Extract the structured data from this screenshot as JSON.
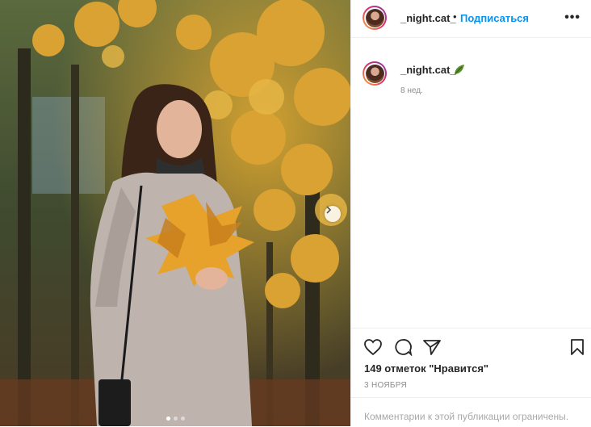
{
  "post": {
    "username": "_night.cat_",
    "separator": "•",
    "follow_label": "Подписаться",
    "more_icon": "more-horizontal-icon",
    "more_label": "•••",
    "caption_time": "8 нед.",
    "caption_icon": "leaf-icon",
    "likes_text": "149 отметок \"Нравится\"",
    "date_text": "3 НОЯБРЯ",
    "comments_disabled": "Комментарии к этой публикации ограничены.",
    "carousel": {
      "current": 1,
      "total": 3
    },
    "icons": [
      "heart-icon",
      "comment-icon",
      "share-icon",
      "bookmark-icon",
      "chevron-right-icon"
    ],
    "colors": {
      "accent": "#0095f6",
      "text": "#262626",
      "muted": "#8e8e8e"
    }
  }
}
